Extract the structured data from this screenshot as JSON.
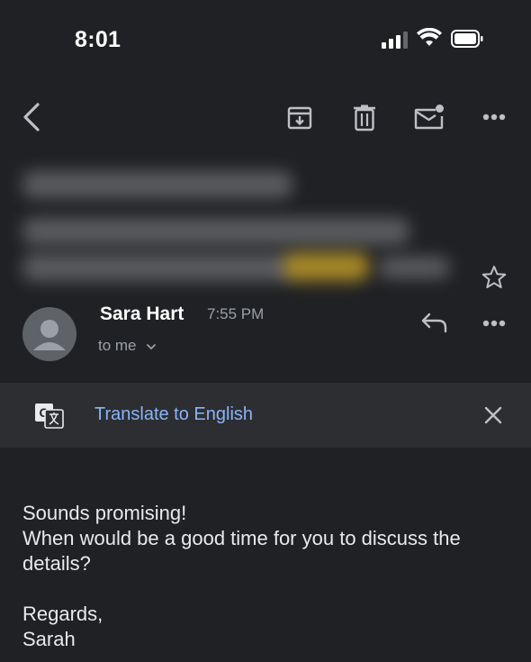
{
  "status_bar": {
    "time": "8:01"
  },
  "toolbar": {
    "back_icon": "chevron-left-icon",
    "archive_icon": "archive-icon",
    "delete_icon": "trash-icon",
    "mark_unread_icon": "mail-unread-icon",
    "more_icon": "more-horizontal-icon"
  },
  "message": {
    "sender_name": "Sara Hart",
    "time": "7:55 PM",
    "recipient": "to me"
  },
  "translate_bar": {
    "label": "Translate to English"
  },
  "body": {
    "line1": "Sounds promising!",
    "line2": "When would be a good time for you to discuss the details?",
    "closing": "Regards,",
    "signature": "Sarah"
  },
  "colors": {
    "background": "#202124",
    "link": "#8ab4f8",
    "translate_bar": "#2d2e31"
  }
}
